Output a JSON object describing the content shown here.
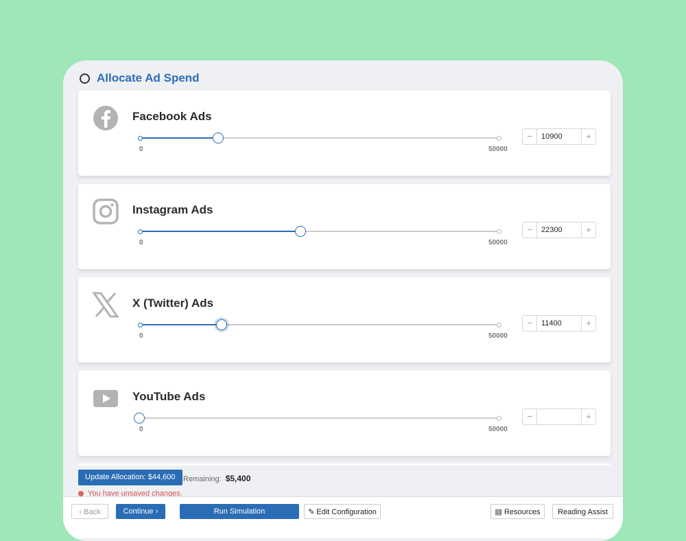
{
  "header": {
    "title": "Allocate Ad Spend"
  },
  "channels": [
    {
      "name": "Facebook Ads",
      "icon": "facebook-icon",
      "value": "10900",
      "min": "0",
      "max": "50000"
    },
    {
      "name": "Instagram Ads",
      "icon": "instagram-icon",
      "value": "22300",
      "min": "0",
      "max": "50000"
    },
    {
      "name": "X (Twitter) Ads",
      "icon": "x-icon",
      "value": "11400",
      "min": "0",
      "max": "50000"
    },
    {
      "name": "YouTube Ads",
      "icon": "youtube-icon",
      "value": "",
      "min": "0",
      "max": "50000"
    }
  ],
  "slider_levels": [
    10900,
    22300,
    11400,
    0
  ],
  "stepper": {
    "minus": "−",
    "plus": "+"
  },
  "allocation": {
    "update_label": "Update Allocation: $44,600",
    "remaining_label": "Remaining:",
    "remaining_value": "$5,400",
    "warning": "You have unsaved changes."
  },
  "footer": {
    "back": "Back",
    "continue": "Continue",
    "run": "Run Simulation",
    "edit": "Edit Configuration",
    "resources": "Resources",
    "reading": "Reading Assist"
  },
  "colors": {
    "accent": "#2a6db5",
    "background": "#9fe6b8",
    "warning": "#d9534f"
  }
}
